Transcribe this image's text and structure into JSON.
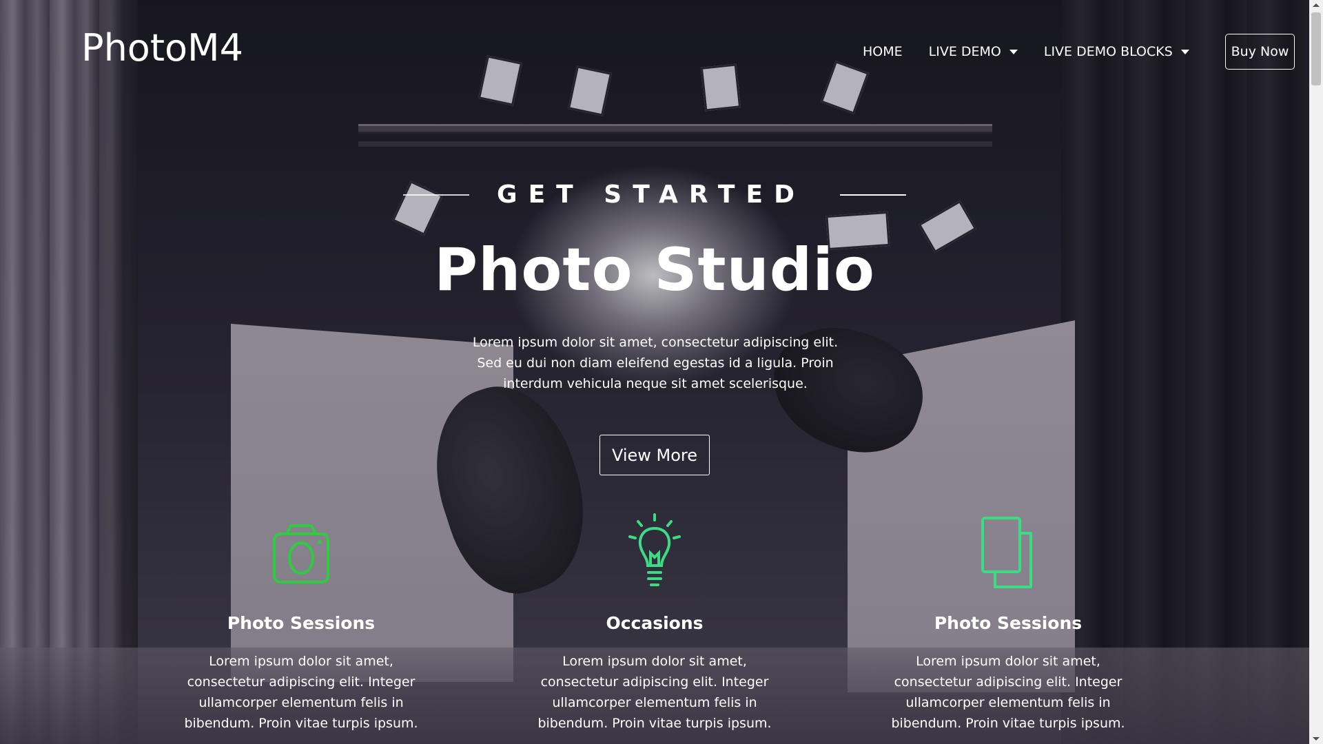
{
  "brand": {
    "name": "PhotoM4"
  },
  "nav": {
    "items": [
      {
        "label": "HOME",
        "dropdown": false
      },
      {
        "label": "LIVE DEMO",
        "dropdown": true
      },
      {
        "label": "LIVE DEMO BLOCKS",
        "dropdown": true
      }
    ],
    "cta_label": "Buy Now"
  },
  "hero": {
    "subtitle": "GET STARTED",
    "title": "Photo Studio",
    "description": "Lorem ipsum dolor sit amet, consectetur adipiscing elit. Sed eu dui non diam eleifend egestas id a ligula. Proin interdum vehicula neque sit amet scelerisque.",
    "button_label": "View More"
  },
  "features": [
    {
      "icon": "camera-icon",
      "title": "Photo Sessions",
      "text": "Lorem ipsum dolor sit amet, consectetur adipiscing elit. Integer ullamcorper elementum felis in bibendum. Proin vitae turpis ipsum."
    },
    {
      "icon": "lightbulb-icon",
      "title": "Occasions",
      "text": "Lorem ipsum dolor sit amet, consectetur adipiscing elit. Integer ullamcorper elementum felis in bibendum. Proin vitae turpis ipsum."
    },
    {
      "icon": "documents-icon",
      "title": "Photo Sessions",
      "text": "Lorem ipsum dolor sit amet, consectetur adipiscing elit. Integer ullamcorper elementum felis in bibendum. Proin vitae turpis ipsum."
    }
  ],
  "colors": {
    "icon_green": "#2ecc40",
    "icon_green_light": "#3ddc84",
    "text": "#ffffff",
    "background_dark": "#1d1b25"
  }
}
